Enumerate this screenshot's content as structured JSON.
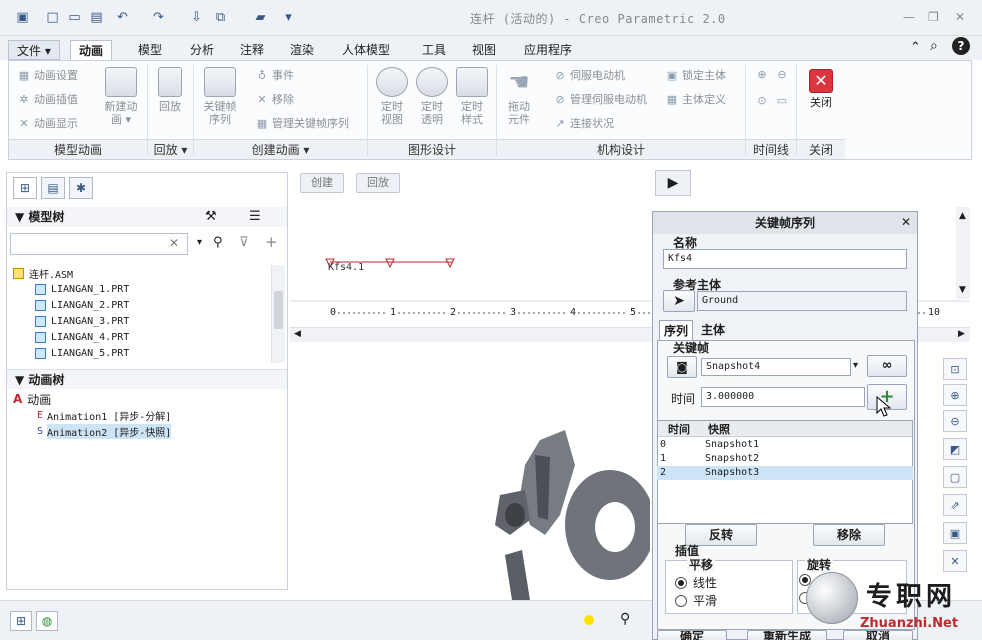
{
  "window": {
    "title": "连杆 (活动的) - Creo Parametric 2.0",
    "minimize": "—",
    "restore": "❐",
    "close": "✕"
  },
  "tabs": [
    "文件",
    "动画",
    "模型",
    "分析",
    "注释",
    "渲染",
    "人体模型",
    "工具",
    "视图",
    "应用程序"
  ],
  "ribbon": {
    "model_anim": {
      "items": [
        "动画设置",
        "动画插值",
        "动画显示"
      ],
      "group": "模型动画"
    },
    "new_anim": {
      "label1": "新建动",
      "label2": "画"
    },
    "playback": {
      "label": "回放",
      "group": "回放"
    },
    "create": {
      "keyframe1": "关键帧",
      "keyframe2": "序列",
      "event": "事件",
      "remove": "移除",
      "manage_kf": "管理关键帧序列",
      "group": "创建动画"
    },
    "graphic": {
      "view1": "定时",
      "view2": "视图",
      "trans1": "定时",
      "trans2": "透明",
      "style1": "定时",
      "style2": "样式",
      "group": "图形设计"
    },
    "mechanism": {
      "drag1": "拖动",
      "drag2": "元件",
      "servo": "伺服电动机",
      "manage_servo": "管理伺服电动机",
      "connect": "连接状况",
      "lock": "锁定主体",
      "body": "主体定义",
      "group": "机构设计"
    },
    "timeline": {
      "group": "时间线"
    },
    "close": {
      "label": "关闭",
      "group": "关闭"
    }
  },
  "left_pane": {
    "model_tree_title": "模型树",
    "tree": [
      "连杆.ASM",
      "LIANGAN_1.PRT",
      "LIANGAN_2.PRT",
      "LIANGAN_3.PRT",
      "LIANGAN_4.PRT",
      "LIANGAN_5.PRT"
    ],
    "anim_tree_title": "动画树",
    "anim_root": "动画",
    "animations": [
      "Animation1 [异步-分解]",
      "Animation2 [异步-快照]"
    ]
  },
  "center": {
    "create_btn": "创建",
    "playback_btn": "回放",
    "kfs_label": "Kfs4.1",
    "ruler": [
      "0",
      "1",
      "2",
      "3",
      "4",
      "5",
      "10"
    ]
  },
  "dialog": {
    "title": "关键帧序列",
    "name_label": "名称",
    "name_value": "Kfs4",
    "ref_label": "参考主体",
    "ref_value": "Ground",
    "tabs": [
      "序列",
      "主体"
    ],
    "keyframe_label": "关键帧",
    "snapshot_value": "Snapshot4",
    "time_label": "时间",
    "time_value": "3.000000",
    "col_time": "时间",
    "col_snapshot": "快照",
    "rows": [
      {
        "time": "0",
        "snapshot": "Snapshot1"
      },
      {
        "time": "1",
        "snapshot": "Snapshot2"
      },
      {
        "time": "2",
        "snapshot": "Snapshot3"
      }
    ],
    "reverse_btn": "反转",
    "remove_btn": "移除",
    "interp_label": "插值",
    "translate_label": "平移",
    "rotate_label": "旋转",
    "linear": "线性",
    "smooth": "平滑",
    "ok_btn": "确定",
    "regen_btn": "重新生成",
    "cancel_btn": "取消"
  },
  "watermark": {
    "cn": "专职网",
    "en": "Zhuanzhi.Net"
  },
  "colors": {
    "accent": "#3a5a86",
    "selected_row": "#cde4f7",
    "timeline_red": "#b4282e"
  }
}
